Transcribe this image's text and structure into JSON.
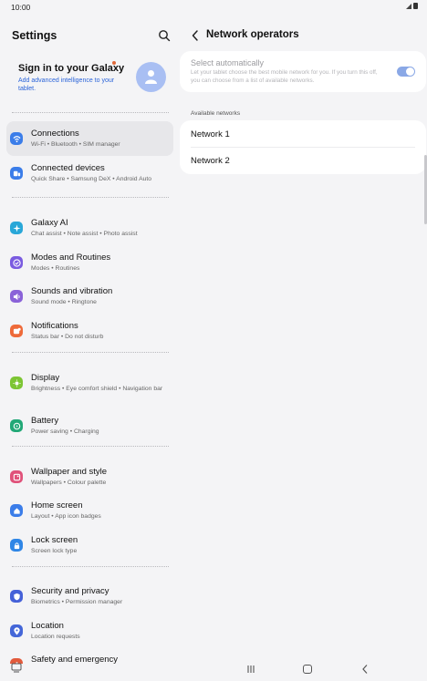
{
  "status_bar": {
    "time": "10:00"
  },
  "left_pane": {
    "title": "Settings",
    "account": {
      "title": "Sign in to your Galaxy",
      "subtitle": "Add advanced intelligence to your tablet."
    },
    "items": [
      {
        "label": "Connections",
        "desc": "Wi-Fi  •  Bluetooth  •  SIM manager",
        "icon": "wifi-icon",
        "color": "#3b7de9"
      },
      {
        "label": "Connected devices",
        "desc": "Quick Share  •  Samsung DeX  •  Android Auto",
        "icon": "devices-icon",
        "color": "#3b7de9"
      },
      {
        "label": "Galaxy AI",
        "desc": "Chat assist  •  Note assist  •  Photo assist",
        "icon": "sparkle-icon",
        "color": "#29a7d8"
      },
      {
        "label": "Modes and Routines",
        "desc": "Modes  •  Routines",
        "icon": "check-circle-icon",
        "color": "#7a5be0"
      },
      {
        "label": "Sounds and vibration",
        "desc": "Sound mode  •  Ringtone",
        "icon": "speaker-icon",
        "color": "#8a62d8"
      },
      {
        "label": "Notifications",
        "desc": "Status bar  •  Do not disturb",
        "icon": "bell-icon",
        "color": "#ee6a3a"
      },
      {
        "label": "Display",
        "desc": "Brightness  •  Eye comfort shield  •  Navigation bar",
        "icon": "sun-icon",
        "color": "#7dc534"
      },
      {
        "label": "Battery",
        "desc": "Power saving  •  Charging",
        "icon": "battery-icon",
        "color": "#22a877"
      },
      {
        "label": "Wallpaper and style",
        "desc": "Wallpapers  •  Colour palette",
        "icon": "image-icon",
        "color": "#e0527a"
      },
      {
        "label": "Home screen",
        "desc": "Layout  •  App icon badges",
        "icon": "home-icon",
        "color": "#3b7de9"
      },
      {
        "label": "Lock screen",
        "desc": "Screen lock type",
        "icon": "lock-icon",
        "color": "#2f86e6"
      },
      {
        "label": "Security and privacy",
        "desc": "Biometrics  •  Permission manager",
        "icon": "shield-icon",
        "color": "#4561d8"
      },
      {
        "label": "Location",
        "desc": "Location requests",
        "icon": "location-icon",
        "color": "#4466d8"
      },
      {
        "label": "Safety and emergency",
        "desc": "",
        "icon": "emergency-icon",
        "color": "#e25a3c"
      }
    ]
  },
  "right_pane": {
    "title": "Network operators",
    "select_auto": {
      "title": "Select automatically",
      "desc": "Let your tablet choose the best mobile network for you. If you turn this off, you can choose from a list of available networks.",
      "toggle": "on"
    },
    "section_label": "Available networks",
    "networks": [
      "Network 1",
      "Network 2"
    ]
  }
}
